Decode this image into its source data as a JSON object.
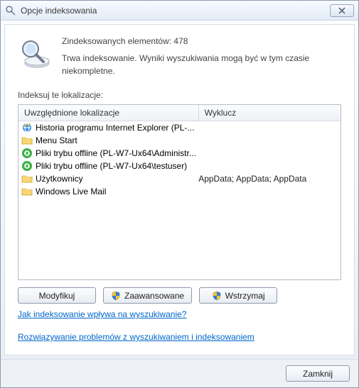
{
  "window": {
    "title": "Opcje indeksowania"
  },
  "header": {
    "count_label": "Zindeksowanych elementów:",
    "count_value": "478",
    "status_line": "Trwa indeksowanie. Wyniki wyszukiwania mogą być w tym czasie niekompletne."
  },
  "section_label": "Indeksuj te lokalizacje:",
  "columns": {
    "included": "Uwzględnione lokalizacje",
    "exclude": "Wyklucz"
  },
  "rows": [
    {
      "icon": "ie",
      "label": "Historia programu Internet Explorer (PL-...",
      "exclude": ""
    },
    {
      "icon": "folder",
      "label": "Menu Start",
      "exclude": ""
    },
    {
      "icon": "sync",
      "label": "Pliki trybu offline (PL-W7-Ux64\\Administr...",
      "exclude": ""
    },
    {
      "icon": "sync",
      "label": "Pliki trybu offline (PL-W7-Ux64\\testuser)",
      "exclude": ""
    },
    {
      "icon": "folder",
      "label": "Użytkownicy",
      "exclude": "AppData; AppData; AppData"
    },
    {
      "icon": "folder",
      "label": "Windows Live Mail",
      "exclude": ""
    }
  ],
  "buttons": {
    "modify": "Modyfikuj",
    "advanced": "Zaawansowane",
    "pause": "Wstrzymaj",
    "close": "Zamknij"
  },
  "links": {
    "how_affects": "Jak indeksowanie wpływa na wyszukiwanie?",
    "troubleshoot": "Rozwiązywanie problemów z wyszukiwaniem i indeksowaniem"
  }
}
